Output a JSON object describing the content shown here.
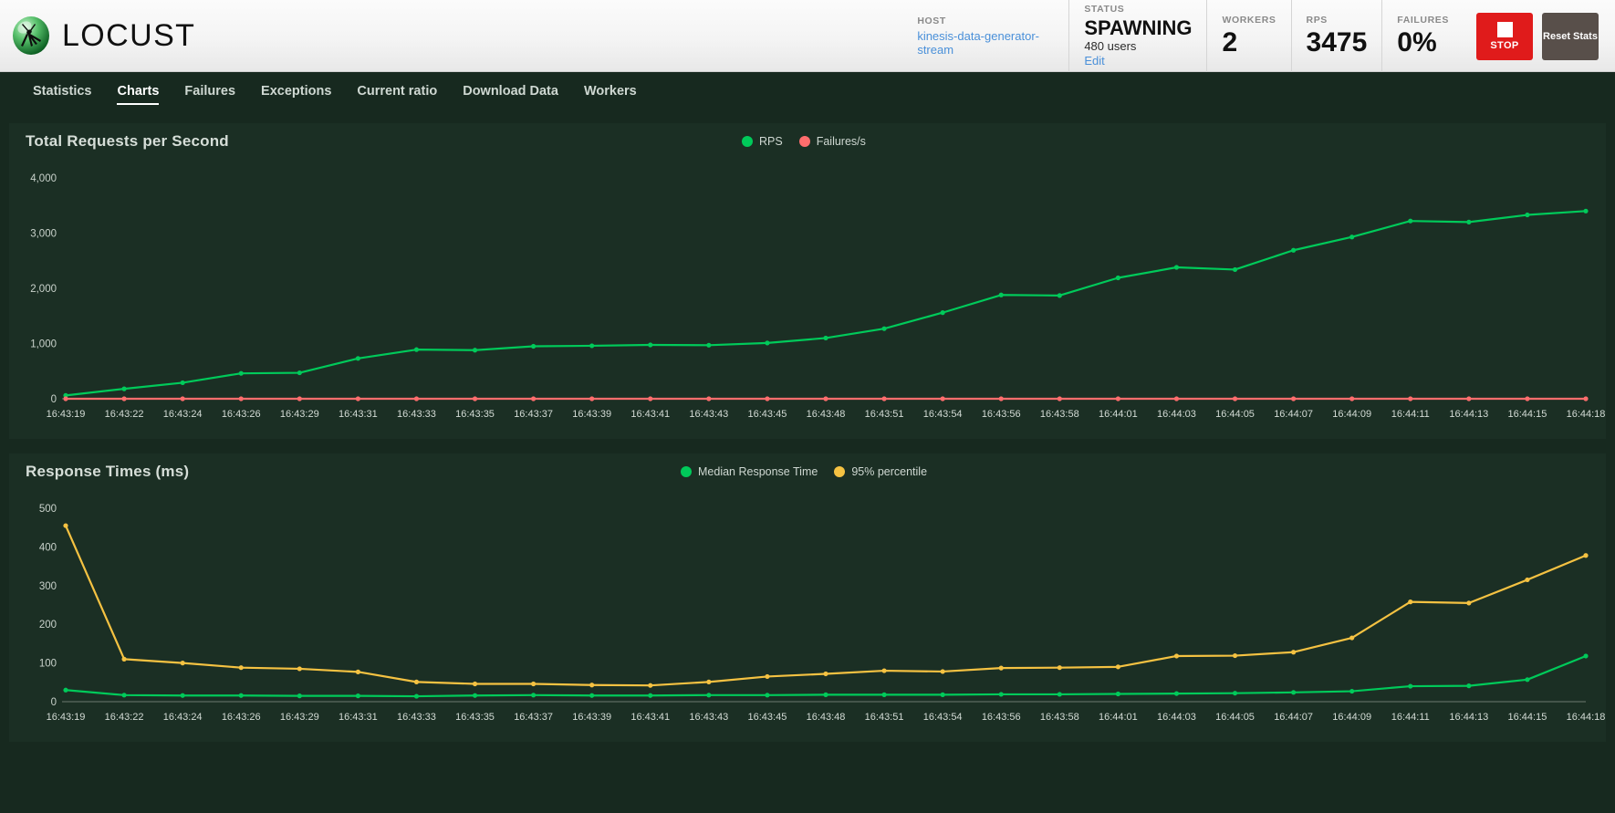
{
  "app": {
    "brand": "LOCUST",
    "logo_icon": "locust-logo-icon"
  },
  "header": {
    "host": {
      "label": "HOST",
      "value": "kinesis-data-generator-stream"
    },
    "status": {
      "label": "STATUS",
      "value": "SPAWNING",
      "users": "480 users",
      "edit_label": "Edit"
    },
    "workers": {
      "label": "WORKERS",
      "value": "2"
    },
    "rps": {
      "label": "RPS",
      "value": "3475"
    },
    "failures": {
      "label": "FAILURES",
      "value": "0%"
    },
    "stop_button": {
      "label": "STOP",
      "icon": "stop-square-icon",
      "color": "#e01b1b"
    },
    "reset_button": {
      "label": "Reset Stats",
      "color": "#584f4a"
    }
  },
  "nav": {
    "tabs": [
      {
        "label": "Statistics",
        "active": false
      },
      {
        "label": "Charts",
        "active": true
      },
      {
        "label": "Failures",
        "active": false
      },
      {
        "label": "Exceptions",
        "active": false
      },
      {
        "label": "Current ratio",
        "active": false
      },
      {
        "label": "Download Data",
        "active": false
      },
      {
        "label": "Workers",
        "active": false
      }
    ]
  },
  "chart_data": [
    {
      "type": "line",
      "title": "Total Requests per Second",
      "xlabel": "",
      "ylabel": "",
      "ylim": [
        0,
        4000
      ],
      "yticks": [
        0,
        1000,
        2000,
        3000,
        4000
      ],
      "ytick_labels": [
        "0",
        "1,000",
        "2,000",
        "3,000",
        "4,000"
      ],
      "grid": false,
      "legend_position": "top-center",
      "x": [
        "16:43:19",
        "16:43:22",
        "16:43:24",
        "16:43:26",
        "16:43:29",
        "16:43:31",
        "16:43:33",
        "16:43:35",
        "16:43:37",
        "16:43:39",
        "16:43:41",
        "16:43:43",
        "16:43:45",
        "16:43:48",
        "16:43:51",
        "16:43:54",
        "16:43:56",
        "16:43:58",
        "16:44:01",
        "16:44:03",
        "16:44:05",
        "16:44:07",
        "16:44:09",
        "16:44:11",
        "16:44:13",
        "16:44:15",
        "16:44:18"
      ],
      "series": [
        {
          "name": "RPS",
          "color": "#00ca5a",
          "values": [
            60,
            180,
            290,
            460,
            470,
            730,
            890,
            880,
            950,
            960,
            975,
            970,
            1010,
            1100,
            1270,
            1560,
            1880,
            1870,
            2190,
            2380,
            2340,
            2690,
            2930,
            3220,
            3200,
            3330,
            3400
          ]
        },
        {
          "name": "Failures/s",
          "color": "#ff6d6d",
          "values": [
            0,
            0,
            0,
            0,
            0,
            0,
            0,
            0,
            0,
            0,
            0,
            0,
            0,
            0,
            0,
            0,
            0,
            0,
            0,
            0,
            0,
            0,
            0,
            0,
            0,
            0,
            0
          ]
        }
      ]
    },
    {
      "type": "line",
      "title": "Response Times (ms)",
      "xlabel": "",
      "ylabel": "",
      "ylim": [
        0,
        500
      ],
      "yticks": [
        0,
        100,
        200,
        300,
        400,
        500
      ],
      "ytick_labels": [
        "0",
        "100",
        "200",
        "300",
        "400",
        "500"
      ],
      "grid": false,
      "legend_position": "top-center",
      "x": [
        "16:43:19",
        "16:43:22",
        "16:43:24",
        "16:43:26",
        "16:43:29",
        "16:43:31",
        "16:43:33",
        "16:43:35",
        "16:43:37",
        "16:43:39",
        "16:43:41",
        "16:43:43",
        "16:43:45",
        "16:43:48",
        "16:43:51",
        "16:43:54",
        "16:43:56",
        "16:43:58",
        "16:44:01",
        "16:44:03",
        "16:44:05",
        "16:44:07",
        "16:44:09",
        "16:44:11",
        "16:44:13",
        "16:44:15",
        "16:44:18"
      ],
      "series": [
        {
          "name": "Median Response Time",
          "color": "#00ca5a",
          "values": [
            30,
            17,
            16,
            16,
            15,
            15,
            14,
            16,
            17,
            16,
            16,
            17,
            17,
            18,
            18,
            18,
            19,
            19,
            20,
            21,
            22,
            24,
            27,
            40,
            41,
            57,
            118
          ]
        },
        {
          "name": "95% percentile",
          "color": "#f5c242",
          "values": [
            455,
            110,
            100,
            88,
            85,
            77,
            51,
            46,
            46,
            43,
            42,
            51,
            65,
            72,
            80,
            78,
            87,
            88,
            90,
            118,
            119,
            128,
            165,
            258,
            255,
            315,
            378
          ]
        }
      ]
    }
  ]
}
